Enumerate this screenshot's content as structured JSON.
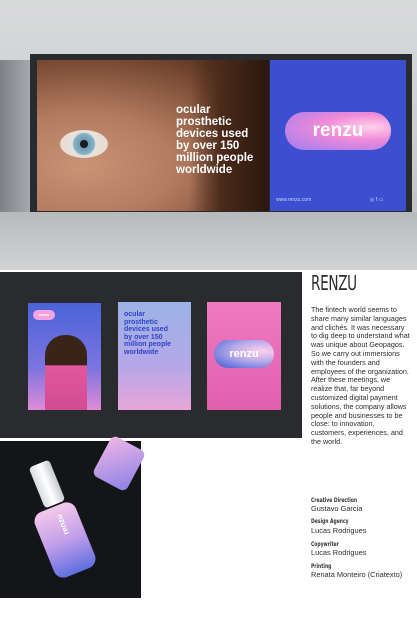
{
  "billboard": {
    "headline_lines": [
      "ocular",
      "prosthetic",
      "devices used",
      "by over 150",
      "million people",
      "worldwide"
    ],
    "logo": "renzu",
    "url": "www.renzu.com"
  },
  "posters": {
    "headline_lines": [
      "ocular",
      "prosthetic",
      "devices used",
      "by over 150",
      "million people",
      "worldwide"
    ],
    "logo": "renzu"
  },
  "bottle": {
    "label": "renzu"
  },
  "article": {
    "brand": "RENZU",
    "body": "The fintech world seems to share many similar languages and clichés. It was necessary to dig deep to understand what was unique about Geopagos. So we carry out immersions with the founders and employees of the organization. After these meetings, we realize that, far beyond customized digital payment solutions, the company allows people and businesses to be close: to innovation, customers, experiences, and the world.",
    "credits": [
      {
        "role": "Creative Direction",
        "name": "Gustavo Garcia"
      },
      {
        "role": "Design Agency",
        "name": "Lucas Rodrigues"
      },
      {
        "role": "Copywriter",
        "name": "Lucas Rodrigues"
      },
      {
        "role": "Printing",
        "name": "Renata Monteiro (Criatexto)"
      }
    ]
  }
}
